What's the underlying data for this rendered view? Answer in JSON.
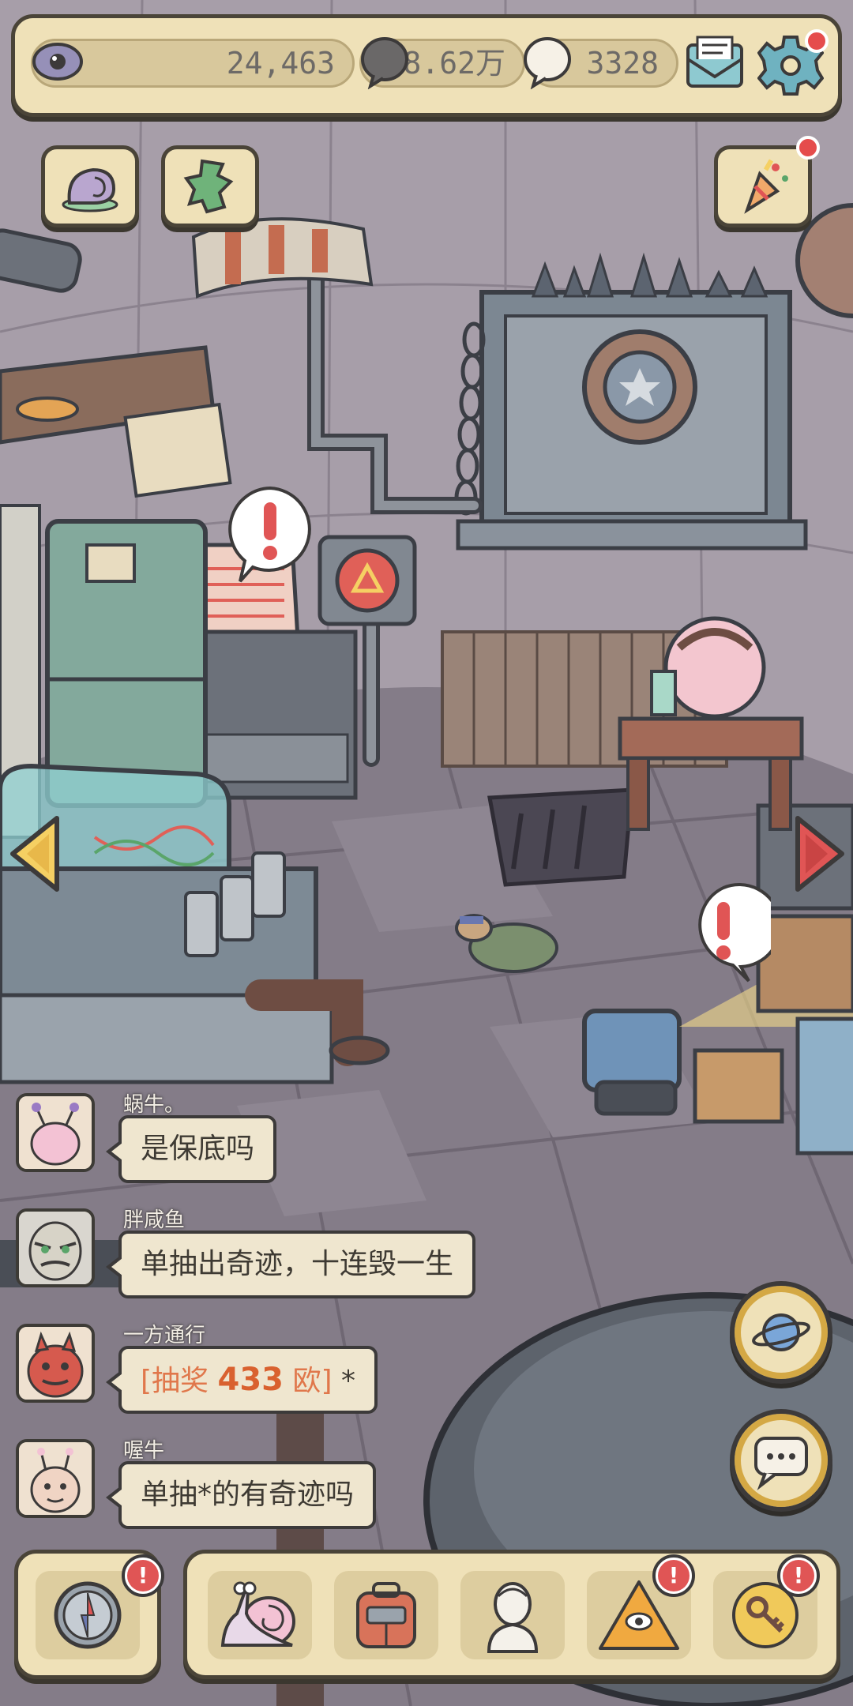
{
  "topbar": {
    "eye_value": "24,463",
    "bubble_value": "8.62万",
    "white_bubble_value": "3328",
    "icons": [
      "eye-icon",
      "speech-bubble-icon",
      "white-speech-bubble-icon",
      "mail-icon",
      "gear-icon"
    ]
  },
  "top_buttons": {
    "left": [
      "snail-shell-icon",
      "map-icon"
    ],
    "right": [
      "party-popper-icon"
    ]
  },
  "chat": {
    "messages": [
      {
        "name": "蜗牛。",
        "text": "是保底吗"
      },
      {
        "name": "胖咸鱼",
        "text": "单抽出奇迹，十连毁一生"
      },
      {
        "name": "一方通行",
        "lottery_prefix": "[抽奖 ",
        "lottery_count": "433",
        "lottery_suffix": " 欧]",
        "tail": " *"
      },
      {
        "name": "喔牛",
        "text": "单抽*的有奇迹吗"
      }
    ]
  },
  "right_buttons": [
    "planet-icon",
    "chat-icon"
  ],
  "bottom_nav": {
    "left": "compass-icon",
    "items": [
      "snail-icon",
      "backpack-icon",
      "bust-statue-icon",
      "pyramid-eye-icon",
      "key-coin-icon"
    ]
  },
  "colors": {
    "panel": "#efe1b8",
    "border": "#4a4438",
    "alert": "#e05555",
    "lottery": "#d9612f"
  }
}
